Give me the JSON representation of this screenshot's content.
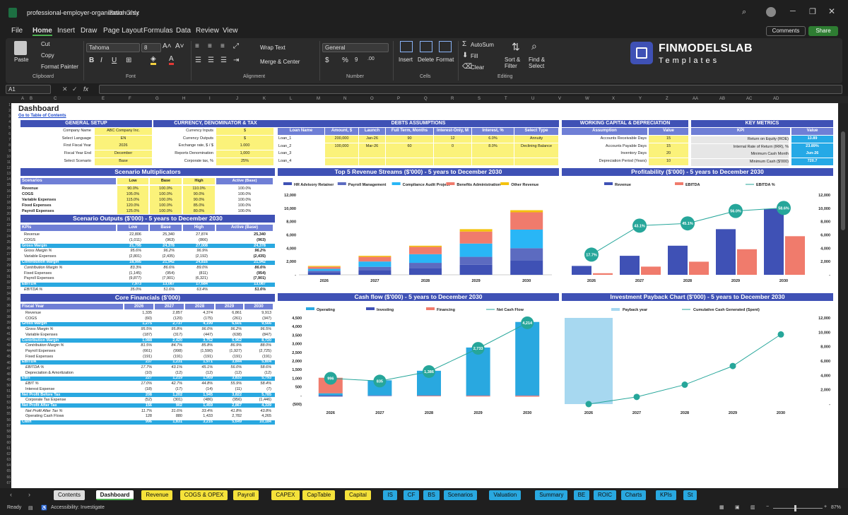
{
  "window": {
    "filename": "professional-employer-organization.xlsx",
    "mode": "Read-Only",
    "comments": "Comments",
    "share": "Share"
  },
  "menu": [
    "File",
    "Home",
    "Insert",
    "Draw",
    "Page Layout",
    "Formulas",
    "Data",
    "Review",
    "View"
  ],
  "ribbon": {
    "paste": "Paste",
    "cut": "Cut",
    "copy": "Copy",
    "format_painter": "Format Painter",
    "clipboard": "Clipboard",
    "font_name": "Tahoma",
    "font_size": "8",
    "font": "Font",
    "wrap_text": "Wrap Text",
    "merge_center": "Merge & Center",
    "alignment": "Alignment",
    "number_format": "General",
    "number": "Number",
    "insert": "Insert",
    "delete": "Delete",
    "format": "Format",
    "cells": "Cells",
    "autosum": "AutoSum",
    "fill": "Fill",
    "clear": "Clear",
    "sort_filter": "Sort & Filter",
    "find_select": "Find & Select",
    "editing": "Editing",
    "brand": "FINMODELSLAB",
    "brand_sub": "Templates"
  },
  "formula_bar": {
    "name_box": "A1",
    "fx": "fx"
  },
  "columns": [
    "A",
    "B",
    "C",
    "D",
    "E",
    "F",
    "G",
    "H",
    "I",
    "J",
    "K",
    "L",
    "M",
    "N",
    "O",
    "P",
    "Q",
    "R",
    "S",
    "T",
    "U",
    "V",
    "W",
    "X",
    "Y",
    "Z",
    "AA",
    "AB",
    "AC",
    "AD"
  ],
  "sheet": {
    "title": "Dashboard",
    "toc": "Go to Table of Contents",
    "general_setup": {
      "title": "GENERAL SETUP",
      "rows": [
        [
          "Company Name",
          "ABC Company Inc."
        ],
        [
          "Select Language",
          "EN"
        ],
        [
          "First Fiscal Year",
          "2026"
        ],
        [
          "Fiscal Year End",
          "December"
        ],
        [
          "Select Scenario",
          "Base"
        ]
      ]
    },
    "currency": {
      "title": "CURRENCY, DENOMINATOR & TAX",
      "rows": [
        [
          "Currency Inputs",
          "$"
        ],
        [
          "Currency Outputs",
          "$"
        ],
        [
          "Exchange rate, $ / $",
          "1.000"
        ],
        [
          "Reports Denomination",
          "1,000"
        ],
        [
          "Corporate tax, %",
          "25%"
        ]
      ]
    },
    "debts": {
      "title": "DEBTS ASSUMPTIONS",
      "headers": [
        "Loan Name",
        "Amount, $",
        "Launch",
        "Full Term, Months",
        "Interest-Only, M",
        "Interest, %",
        "Select Type"
      ],
      "rows": [
        [
          "Loan_1",
          "200,000",
          "Jan-26",
          "90",
          "12",
          "6.0%",
          "Annuity"
        ],
        [
          "Loan_2",
          "100,000",
          "Mar-26",
          "60",
          "0",
          "8.0%",
          "Declining Balance"
        ],
        [
          "Loan_3",
          "",
          "",
          "",
          "",
          "",
          ""
        ],
        [
          "Loan_4",
          "",
          "",
          "",
          "",
          "",
          ""
        ]
      ]
    },
    "wc": {
      "title": "WORKING CAPITAL & DEPRECIATION",
      "headers": [
        "Assumption",
        "Value"
      ],
      "rows": [
        [
          "Accounts Receivable Days",
          "15"
        ],
        [
          "Accounts Payable Days",
          "15"
        ],
        [
          "Inventory Days",
          "20"
        ],
        [
          "Depreciation Period (Years)",
          "10"
        ]
      ]
    },
    "kpi": {
      "title": "KEY METRICS",
      "headers": [
        "KPI",
        "Value"
      ],
      "rows": [
        [
          "Return on Equity (ROE)",
          "13.89"
        ],
        [
          "Internal Rate of Return (IRR), %",
          "23.89%"
        ],
        [
          "Minimum Cash Month",
          "Jun-26"
        ],
        [
          "Minimum Cash ($'000)",
          "720.7"
        ]
      ]
    },
    "scen_mult": {
      "title": "Scenario Multiplicators",
      "headers": [
        "Scenarios",
        "Low",
        "Base",
        "High",
        "Active (Base)"
      ],
      "rows": [
        [
          "Revenue",
          "90.0%",
          "100.0%",
          "110.0%",
          "100.0%"
        ],
        [
          "COGS",
          "105.0%",
          "100.0%",
          "90.0%",
          "100.0%"
        ],
        [
          "Variable Expenses",
          "115.0%",
          "100.0%",
          "90.0%",
          "100.0%"
        ],
        [
          "Fixed Expenses",
          "120.0%",
          "100.0%",
          "85.0%",
          "100.0%"
        ],
        [
          "Payroll Expenses",
          "125.0%",
          "100.0%",
          "80.0%",
          "100.0%"
        ]
      ]
    },
    "scen_out": {
      "title": "Scenario Outputs ($'000) - 5 years to December 2030",
      "headers": [
        "KPIs",
        "Low",
        "Base",
        "High",
        "Active (Base)"
      ],
      "rows": [
        [
          "Revenue",
          "22,806",
          "25,340",
          "27,874",
          "25,340",
          "n"
        ],
        [
          "COGS",
          "(1,011)",
          "(963)",
          "(866)",
          "(963)",
          "n"
        ],
        [
          "Gross Margin",
          "21,795",
          "24,378",
          "27,008",
          "24,378",
          "h"
        ],
        [
          "Gross Margin %",
          "95.6%",
          "96.2%",
          "96.9%",
          "96.2%",
          "i"
        ],
        [
          "Variable Expenses",
          "(2,801)",
          "(2,435)",
          "(2,192)",
          "(2,435)",
          "n"
        ],
        [
          "Contribution Margin",
          "18,995",
          "21,942",
          "24,816",
          "21,942",
          "h"
        ],
        [
          "Contribution Margin %",
          "83.3%",
          "86.6%",
          "89.0%",
          "86.6%",
          "i"
        ],
        [
          "Fixed Expenses",
          "(1,145)",
          "(954)",
          "(811)",
          "(954)",
          "n"
        ],
        [
          "Payroll Expenses",
          "(9,877)",
          "(7,901)",
          "(6,321)",
          "(7,901)",
          "n"
        ],
        [
          "EBITDA",
          "7,973",
          "13,087",
          "17,684",
          "13,087",
          "h"
        ],
        [
          "EBITDA %",
          "35.0%",
          "51.6%",
          "63.4%",
          "51.6%",
          "i"
        ]
      ]
    },
    "core": {
      "title": "Core Financials ($'000)",
      "headers": [
        "Fiscal Year",
        "2026",
        "2027",
        "2028",
        "2029",
        "2030"
      ],
      "rows": [
        [
          "Revenue",
          "1,335",
          "2,857",
          "4,374",
          "6,861",
          "9,913",
          "n"
        ],
        [
          "COGS",
          "(60)",
          "(120)",
          "(175)",
          "(261)",
          "(347)",
          "n"
        ],
        [
          "Gross Margin",
          "1,275",
          "2,737",
          "4,199",
          "6,601",
          "9,566",
          "h"
        ],
        [
          "Gross Margin %",
          "95.5%",
          "95.8%",
          "96.0%",
          "96.2%",
          "96.5%",
          "i"
        ],
        [
          "Variable Expenses",
          "(187)",
          "(317)",
          "(447)",
          "(638)",
          "(847)",
          "n"
        ],
        [
          "Contribution Margin",
          "1,088",
          "2,420",
          "3,752",
          "5,962",
          "8,720",
          "h"
        ],
        [
          "Contribution Margin %",
          "81.5%",
          "84.7%",
          "85.8%",
          "86.9%",
          "88.0%",
          "i"
        ],
        [
          "Payroll Expenses",
          "(661)",
          "(998)",
          "(1,590)",
          "(1,927)",
          "(2,725)",
          "n"
        ],
        [
          "Fixed Expenses",
          "(191)",
          "(191)",
          "(191)",
          "(191)",
          "(191)",
          "n"
        ],
        [
          "EBITDA",
          "237",
          "1,231",
          "1,971",
          "3,844",
          "5,804",
          "h"
        ],
        [
          "EBITDA %",
          "17.7%",
          "43.1%",
          "45.1%",
          "56.0%",
          "58.6%",
          "i"
        ],
        [
          "Depreciation & Amortization",
          "(10)",
          "(12)",
          "(12)",
          "(12)",
          "(12)",
          "n"
        ],
        [
          "EBIT",
          "227",
          "1,219",
          "1,959",
          "3,833",
          "5,793",
          "h"
        ],
        [
          "EBIT %",
          "17.0%",
          "42.7%",
          "44.8%",
          "55.9%",
          "58.4%",
          "i"
        ],
        [
          "Interest Expense",
          "(18)",
          "(17)",
          "(14)",
          "(11)",
          "(7)",
          "n"
        ],
        [
          "Net Profit Before Tax",
          "208",
          "1,202",
          "1,945",
          "3,822",
          "5,785",
          "h"
        ],
        [
          "Corporate Tax Expense",
          "(52)",
          "(301)",
          "(486)",
          "(956)",
          "(1,446)",
          "n"
        ],
        [
          "Net Profit After Tax",
          "156",
          "902",
          "1,459",
          "2,867",
          "4,339",
          "h"
        ],
        [
          "Net Profit After Tax %",
          "11.7%",
          "31.6%",
          "33.4%",
          "41.8%",
          "43.8%",
          "i"
        ],
        [
          "Operating Cash Flows",
          "128",
          "880",
          "1,433",
          "2,782",
          "4,265",
          "n"
        ],
        [
          "Cash",
          "996",
          "1,831",
          "3,216",
          "5,649",
          "10,184",
          "h"
        ]
      ]
    }
  },
  "chart_data": [
    {
      "type": "bar",
      "title": "Top 5 Revenue Streams ($'000) - 5 years to December 2030",
      "categories": [
        "2026",
        "2027",
        "2028",
        "2029",
        "2030"
      ],
      "ylim": [
        0,
        12000
      ],
      "yticks": [
        "12,000",
        "10,000",
        "8,000",
        "6,000",
        "4,000",
        "2,000",
        "-"
      ],
      "series": [
        {
          "name": "HR Advisory Retainer",
          "color": "#3f51b5",
          "values": [
            400,
            700,
            1000,
            1500,
            2200
          ]
        },
        {
          "name": "Payroll Management",
          "color": "#5c6bc0",
          "values": [
            200,
            500,
            800,
            1200,
            1800
          ]
        },
        {
          "name": "Compliance Audit Project",
          "color": "#29b6f6",
          "values": [
            300,
            800,
            1300,
            2000,
            2800
          ]
        },
        {
          "name": "Benefits Administration",
          "color": "#f07b6c",
          "values": [
            300,
            700,
            1100,
            1800,
            2600
          ]
        },
        {
          "name": "Other Revenue",
          "color": "#f4c20d",
          "values": [
            135,
            157,
            174,
            361,
            313
          ]
        }
      ]
    },
    {
      "type": "bar",
      "title": "Profitability ($'000) - 5 years to December 2030",
      "categories": [
        "2026",
        "2027",
        "2028",
        "2029",
        "2030"
      ],
      "ylim": [
        0,
        12000
      ],
      "yticks": [
        "12,000",
        "10,000",
        "8,000",
        "6,000",
        "4,000",
        "2,000",
        "-"
      ],
      "y2labels": [
        "17.7%",
        "43.1%",
        "45.1%",
        "56.0%",
        "58.6%"
      ],
      "series": [
        {
          "name": "Revenue",
          "color": "#3f51b5",
          "values": [
            1335,
            2857,
            4374,
            6861,
            9913
          ]
        },
        {
          "name": "EBITDA",
          "color": "#f07b6c",
          "values": [
            237,
            1231,
            1971,
            3844,
            5804
          ]
        },
        {
          "name": "EBITDA %",
          "color": "#26a69a",
          "values": [
            17.7,
            43.1,
            45.1,
            56.0,
            58.6
          ]
        }
      ]
    },
    {
      "type": "bar",
      "title": "Cash flow ($'000) - 5 years to December 2030",
      "categories": [
        "2026",
        "2027",
        "2028",
        "2029",
        "2030"
      ],
      "ylim": [
        -500,
        4500
      ],
      "yticks": [
        "4,500",
        "4,000",
        "3,500",
        "3,000",
        "2,500",
        "2,000",
        "1,500",
        "1,000",
        "500",
        "-",
        "(500)"
      ],
      "series": [
        {
          "name": "Operating",
          "color": "#29a8e0",
          "values": [
            128,
            880,
            1433,
            2782,
            4265
          ]
        },
        {
          "name": "Investing",
          "color": "#3f51b5",
          "values": [
            -60,
            -30,
            -20,
            -20,
            -20
          ]
        },
        {
          "name": "Financing",
          "color": "#f07b6c",
          "values": [
            900,
            0,
            -30,
            -40,
            -50
          ]
        },
        {
          "name": "Net Cash Flow",
          "color": "#26a69a",
          "values": [
            996,
            835,
            1386,
            2733,
            4214
          ]
        }
      ],
      "labels": [
        "996",
        "835",
        "1,386",
        "2,733",
        "4,214"
      ]
    },
    {
      "type": "line",
      "title": "Investment Payback Chart ($'000) - 5 years to December 2030",
      "categories": [
        "2026",
        "2027",
        "2028",
        "2029",
        "2030"
      ],
      "ylim": [
        0,
        12000
      ],
      "yticks": [
        "12,000",
        "10,000",
        "8,000",
        "6,000",
        "4,000",
        "2,000",
        "-"
      ],
      "series": [
        {
          "name": "Payback year",
          "color": "#a7d8f0",
          "values": [
            1,
            0,
            0,
            0,
            0
          ]
        },
        {
          "name": "Cumulative Cash Generated (Spent)",
          "color": "#26a69a",
          "values": [
            0,
            1000,
            2700,
            5300,
            9700
          ]
        }
      ]
    }
  ],
  "sheet_tabs": [
    [
      "Contents",
      "#dddddd"
    ],
    [
      "Dashboard",
      "#ffffff"
    ],
    [
      "Revenue",
      "#f5e23a"
    ],
    [
      "COGS & OPEX",
      "#f5e23a"
    ],
    [
      "Payroll",
      "#f5e23a"
    ],
    [
      "CAPEX",
      "#f5e23a"
    ],
    [
      "CapTable",
      "#f5e23a"
    ],
    [
      "Capital",
      "#f5e23a"
    ],
    [
      "IS",
      "#29a8e0"
    ],
    [
      "CF",
      "#29a8e0"
    ],
    [
      "BS",
      "#29a8e0"
    ],
    [
      "Scenarios",
      "#29a8e0"
    ],
    [
      "Valuation",
      "#29a8e0"
    ],
    [
      "Summary",
      "#29a8e0"
    ],
    [
      "BE",
      "#29a8e0"
    ],
    [
      "ROIC",
      "#29a8e0"
    ],
    [
      "Charts",
      "#29a8e0"
    ],
    [
      "KPIs",
      "#29a8e0"
    ],
    [
      "St",
      "#29a8e0"
    ]
  ],
  "status": {
    "ready": "Ready",
    "accessibility": "Accessibility: Investigate",
    "zoom": "87%"
  }
}
